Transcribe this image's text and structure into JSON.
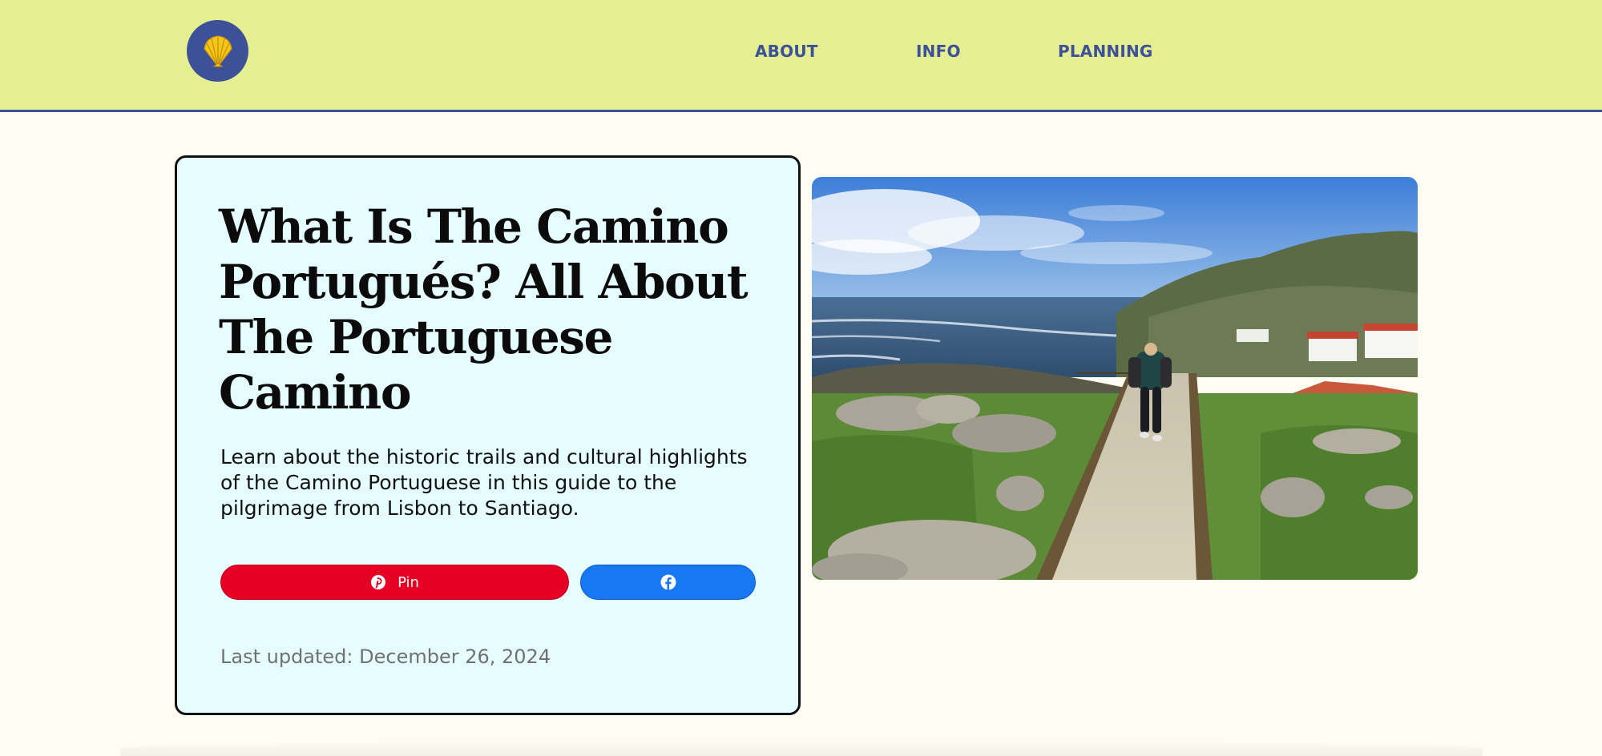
{
  "header": {
    "logo_icon": "scallop-shell-icon",
    "nav": [
      {
        "label": "ABOUT"
      },
      {
        "label": "INFO"
      },
      {
        "label": "PLANNING"
      }
    ]
  },
  "article": {
    "title": "What Is The Camino Portugués? All About The Portuguese Camino",
    "subtitle": "Learn about the historic trails and cultural highlights of the Camino Portuguese in this guide to the pilgrimage from Lisbon to Santiago.",
    "share": {
      "pin_label": "Pin",
      "pin_icon": "pinterest-icon",
      "facebook_icon": "facebook-icon"
    },
    "last_updated": "Last updated: December 26, 2024"
  },
  "colors": {
    "header_bg": "#e5ee90",
    "brand_blue": "#3d5199",
    "card_bg": "#e5fdff",
    "pinterest_red": "#e60023",
    "facebook_blue": "#1877f2"
  }
}
